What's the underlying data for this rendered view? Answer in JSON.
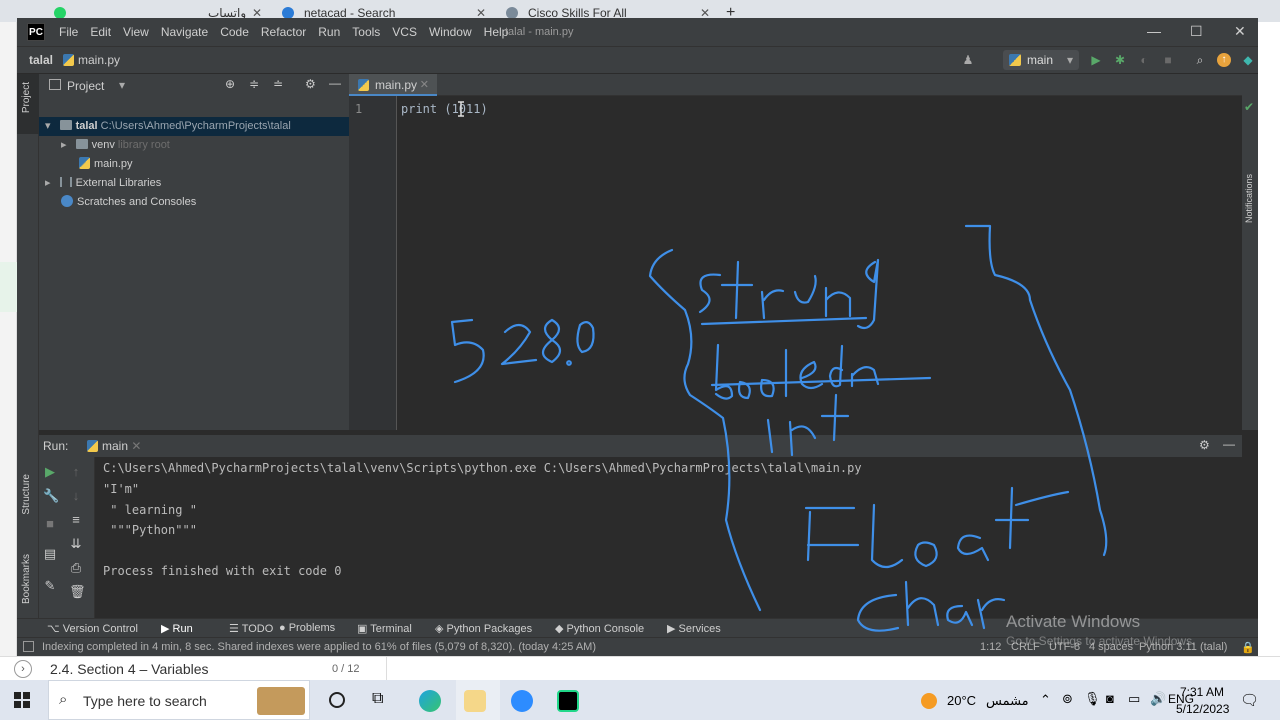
{
  "browser": {
    "tabs": [
      {
        "title": "واتساب",
        "color": "#25d366"
      },
      {
        "title": "netacad - Search",
        "color": "#2b7bd6"
      },
      {
        "title": "Cisco Skills For All",
        "color": "#7a8a99"
      }
    ],
    "new_tab": "+"
  },
  "ide": {
    "logo": "PC",
    "menu": [
      "File",
      "Edit",
      "View",
      "Navigate",
      "Code",
      "Refactor",
      "Run",
      "Tools",
      "VCS",
      "Window",
      "Help"
    ],
    "window_title": "talal - main.py",
    "breadcrumb": {
      "project": "talal",
      "file": "main.py"
    },
    "run_config": "main",
    "project_panel": {
      "title": "Project",
      "tree": [
        {
          "label": "talal",
          "extra": "C:\\Users\\Ahmed\\PycharmProjects\\talal"
        },
        {
          "label": "venv",
          "extra": "library root"
        },
        {
          "label": "main.py",
          "extra": ""
        },
        {
          "label": "External Libraries",
          "extra": ""
        },
        {
          "label": "Scratches and Consoles",
          "extra": ""
        }
      ]
    },
    "left_strip_labels": [
      "Project",
      "Structure",
      "Bookmarks"
    ],
    "right_strip_label": "Notifications",
    "editor": {
      "tab": "main.py",
      "line_number": "1",
      "code": "print (1011)"
    },
    "run_panel": {
      "label": "Run:",
      "tab": "main",
      "output": [
        "C:\\Users\\Ahmed\\PycharmProjects\\talal\\venv\\Scripts\\python.exe C:\\Users\\Ahmed\\PycharmProjects\\talal\\main.py",
        "\"I'm\"",
        " \" learning \"",
        " \"\"\"Python\"\"\"",
        "",
        "Process finished with exit code 0"
      ]
    },
    "tool_tabs": [
      "Version Control",
      "Run",
      "TODO",
      "Problems",
      "Terminal",
      "Python Packages",
      "Python Console",
      "Services"
    ],
    "status": {
      "message": "Indexing completed in 4 min, 8 sec. Shared indexes were applied to 61% of files (5,079 of 8,320). (today 4:25 AM)",
      "position": "1:12",
      "line_sep": "CRLF",
      "encoding": "UTF-8",
      "indent": "4 spaces",
      "interpreter": "Python 3.11 (talal)"
    }
  },
  "watermark": {
    "title": "Activate Windows",
    "sub": "Go to Settings to activate Windows."
  },
  "course": {
    "section": "2.4. Section 4 – Variables",
    "progress": "0 / 12"
  },
  "taskbar": {
    "search_placeholder": "Type here to search",
    "weather_temp": "20°C",
    "weather_text": "مشمس",
    "time": "7:31 AM",
    "date": "5/12/2023"
  },
  "handwriting": [
    "528.0",
    "string",
    "booleon",
    "int",
    "Float",
    "Char"
  ],
  "colors": {
    "ink": "#3f8fe8",
    "ide_bg": "#2b2b2b",
    "panel": "#3c3f41",
    "selection": "#0d293e"
  }
}
